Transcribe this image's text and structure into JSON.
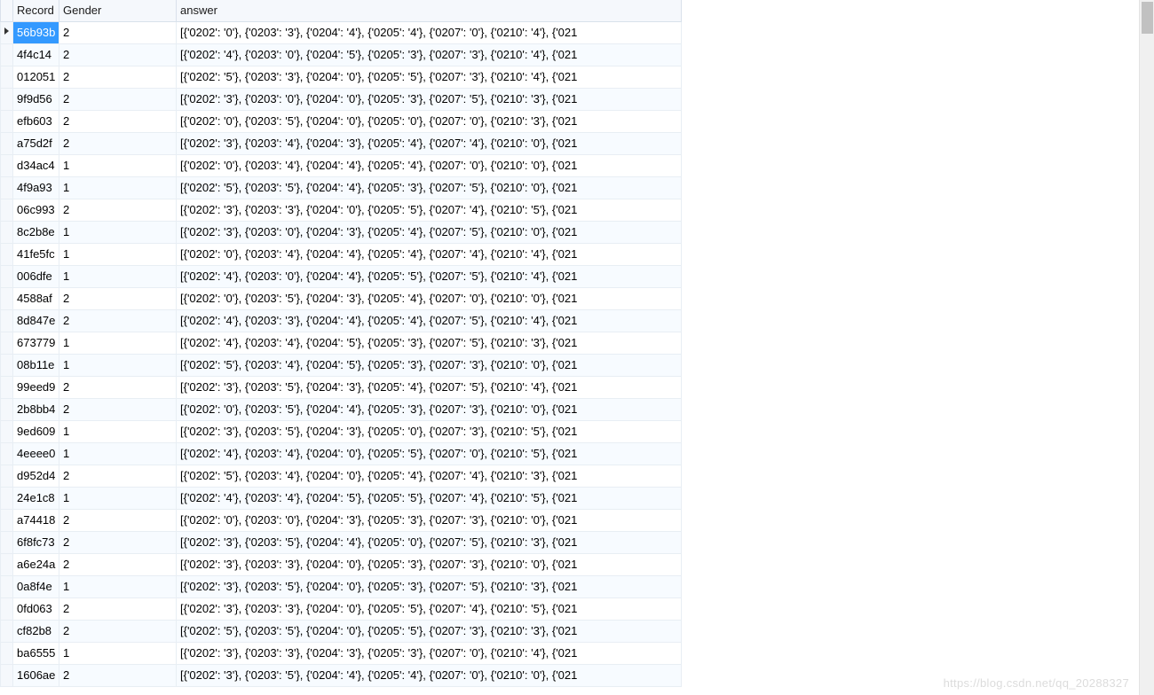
{
  "columns": {
    "record": "Record",
    "gender": "Gender",
    "answer": "answer"
  },
  "rows": [
    {
      "indicator": "►",
      "record": "56b93b",
      "gender": "2",
      "answer": "[{'0202': '0'}, {'0203': '3'}, {'0204': '4'}, {'0205': '4'}, {'0207': '0'}, {'0210': '4'}, {'021",
      "selected": true
    },
    {
      "indicator": "",
      "record": "4f4c14",
      "gender": "2",
      "answer": "[{'0202': '4'}, {'0203': '0'}, {'0204': '5'}, {'0205': '3'}, {'0207': '3'}, {'0210': '4'}, {'021"
    },
    {
      "indicator": "",
      "record": "012051",
      "gender": "2",
      "answer": "[{'0202': '5'}, {'0203': '3'}, {'0204': '0'}, {'0205': '5'}, {'0207': '3'}, {'0210': '4'}, {'021"
    },
    {
      "indicator": "",
      "record": "9f9d56",
      "gender": "2",
      "answer": "[{'0202': '3'}, {'0203': '0'}, {'0204': '0'}, {'0205': '3'}, {'0207': '5'}, {'0210': '3'}, {'021"
    },
    {
      "indicator": "",
      "record": "efb603",
      "gender": "2",
      "answer": "[{'0202': '0'}, {'0203': '5'}, {'0204': '0'}, {'0205': '0'}, {'0207': '0'}, {'0210': '3'}, {'021"
    },
    {
      "indicator": "",
      "record": "a75d2f",
      "gender": "2",
      "answer": "[{'0202': '3'}, {'0203': '4'}, {'0204': '3'}, {'0205': '4'}, {'0207': '4'}, {'0210': '0'}, {'021"
    },
    {
      "indicator": "",
      "record": "d34ac4",
      "gender": "1",
      "answer": "[{'0202': '0'}, {'0203': '4'}, {'0204': '4'}, {'0205': '4'}, {'0207': '0'}, {'0210': '0'}, {'021"
    },
    {
      "indicator": "",
      "record": "4f9a93",
      "gender": "1",
      "answer": "[{'0202': '5'}, {'0203': '5'}, {'0204': '4'}, {'0205': '3'}, {'0207': '5'}, {'0210': '0'}, {'021"
    },
    {
      "indicator": "",
      "record": "06c993",
      "gender": "2",
      "answer": "[{'0202': '3'}, {'0203': '3'}, {'0204': '0'}, {'0205': '5'}, {'0207': '4'}, {'0210': '5'}, {'021"
    },
    {
      "indicator": "",
      "record": "8c2b8e",
      "gender": "1",
      "answer": "[{'0202': '3'}, {'0203': '0'}, {'0204': '3'}, {'0205': '4'}, {'0207': '5'}, {'0210': '0'}, {'021"
    },
    {
      "indicator": "",
      "record": "41fe5fc",
      "gender": "1",
      "answer": "[{'0202': '0'}, {'0203': '4'}, {'0204': '4'}, {'0205': '4'}, {'0207': '4'}, {'0210': '4'}, {'021"
    },
    {
      "indicator": "",
      "record": "006dfe",
      "gender": "1",
      "answer": "[{'0202': '4'}, {'0203': '0'}, {'0204': '4'}, {'0205': '5'}, {'0207': '5'}, {'0210': '4'}, {'021"
    },
    {
      "indicator": "",
      "record": "4588af",
      "gender": "2",
      "answer": "[{'0202': '0'}, {'0203': '5'}, {'0204': '3'}, {'0205': '4'}, {'0207': '0'}, {'0210': '0'}, {'021"
    },
    {
      "indicator": "",
      "record": "8d847e",
      "gender": "2",
      "answer": "[{'0202': '4'}, {'0203': '3'}, {'0204': '4'}, {'0205': '4'}, {'0207': '5'}, {'0210': '4'}, {'021"
    },
    {
      "indicator": "",
      "record": "673779",
      "gender": "1",
      "answer": "[{'0202': '4'}, {'0203': '4'}, {'0204': '5'}, {'0205': '3'}, {'0207': '5'}, {'0210': '3'}, {'021"
    },
    {
      "indicator": "",
      "record": "08b11e",
      "gender": "1",
      "answer": "[{'0202': '5'}, {'0203': '4'}, {'0204': '5'}, {'0205': '3'}, {'0207': '3'}, {'0210': '0'}, {'021"
    },
    {
      "indicator": "",
      "record": "99eed9",
      "gender": "2",
      "answer": "[{'0202': '3'}, {'0203': '5'}, {'0204': '3'}, {'0205': '4'}, {'0207': '5'}, {'0210': '4'}, {'021"
    },
    {
      "indicator": "",
      "record": "2b8bb4",
      "gender": "2",
      "answer": "[{'0202': '0'}, {'0203': '5'}, {'0204': '4'}, {'0205': '3'}, {'0207': '3'}, {'0210': '0'}, {'021"
    },
    {
      "indicator": "",
      "record": "9ed609",
      "gender": "1",
      "answer": "[{'0202': '3'}, {'0203': '5'}, {'0204': '3'}, {'0205': '0'}, {'0207': '3'}, {'0210': '5'}, {'021"
    },
    {
      "indicator": "",
      "record": "4eeee0",
      "gender": "1",
      "answer": "[{'0202': '4'}, {'0203': '4'}, {'0204': '0'}, {'0205': '5'}, {'0207': '0'}, {'0210': '5'}, {'021"
    },
    {
      "indicator": "",
      "record": "d952d4",
      "gender": "2",
      "answer": "[{'0202': '5'}, {'0203': '4'}, {'0204': '0'}, {'0205': '4'}, {'0207': '4'}, {'0210': '3'}, {'021"
    },
    {
      "indicator": "",
      "record": "24e1c8",
      "gender": "1",
      "answer": "[{'0202': '4'}, {'0203': '4'}, {'0204': '5'}, {'0205': '5'}, {'0207': '4'}, {'0210': '5'}, {'021"
    },
    {
      "indicator": "",
      "record": "a74418",
      "gender": "2",
      "answer": "[{'0202': '0'}, {'0203': '0'}, {'0204': '3'}, {'0205': '3'}, {'0207': '3'}, {'0210': '0'}, {'021"
    },
    {
      "indicator": "",
      "record": "6f8fc73",
      "gender": "2",
      "answer": "[{'0202': '3'}, {'0203': '5'}, {'0204': '4'}, {'0205': '0'}, {'0207': '5'}, {'0210': '3'}, {'021"
    },
    {
      "indicator": "",
      "record": "a6e24a",
      "gender": "2",
      "answer": "[{'0202': '3'}, {'0203': '3'}, {'0204': '0'}, {'0205': '3'}, {'0207': '3'}, {'0210': '0'}, {'021"
    },
    {
      "indicator": "",
      "record": "0a8f4e",
      "gender": "1",
      "answer": "[{'0202': '3'}, {'0203': '5'}, {'0204': '0'}, {'0205': '3'}, {'0207': '5'}, {'0210': '3'}, {'021"
    },
    {
      "indicator": "",
      "record": "0fd063",
      "gender": "2",
      "answer": "[{'0202': '3'}, {'0203': '3'}, {'0204': '0'}, {'0205': '5'}, {'0207': '4'}, {'0210': '5'}, {'021"
    },
    {
      "indicator": "",
      "record": "cf82b8",
      "gender": "2",
      "answer": "[{'0202': '5'}, {'0203': '5'}, {'0204': '0'}, {'0205': '5'}, {'0207': '3'}, {'0210': '3'}, {'021"
    },
    {
      "indicator": "",
      "record": "ba6555",
      "gender": "1",
      "answer": "[{'0202': '3'}, {'0203': '3'}, {'0204': '3'}, {'0205': '3'}, {'0207': '0'}, {'0210': '4'}, {'021"
    },
    {
      "indicator": "",
      "record": "1606ae",
      "gender": "2",
      "answer": "[{'0202': '3'}, {'0203': '5'}, {'0204': '4'}, {'0205': '4'}, {'0207': '0'}, {'0210': '0'}, {'021"
    }
  ],
  "watermark": "https://blog.csdn.net/qq_20288327"
}
